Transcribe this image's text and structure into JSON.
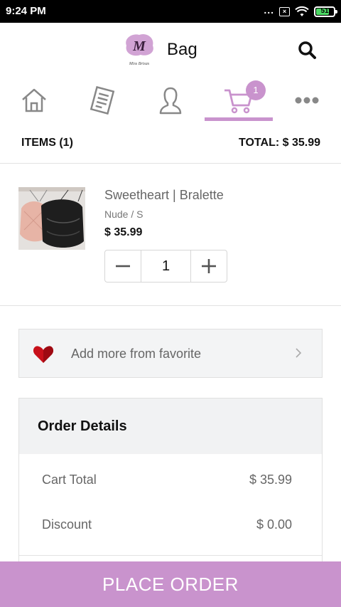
{
  "status_bar": {
    "time": "9:24 PM",
    "dots": "...",
    "battery": "51"
  },
  "header": {
    "title": "Bag",
    "logo_letter": "M",
    "logo_caption": "Miss Brisas"
  },
  "nav": {
    "items": [
      {
        "icon": "home-icon"
      },
      {
        "icon": "catalog-icon"
      },
      {
        "icon": "profile-icon"
      },
      {
        "icon": "cart-icon",
        "active": true,
        "badge": "1"
      },
      {
        "icon": "more-icon"
      }
    ],
    "accent": "#c993cd"
  },
  "summary": {
    "items_label": "ITEMS (1)",
    "total_label": "TOTAL: $ 35.99"
  },
  "product": {
    "name": "Sweetheart | Bralette",
    "variant": "Nude / S",
    "price": "$ 35.99",
    "quantity": "1"
  },
  "favorite": {
    "label": "Add more from favorite"
  },
  "order_details": {
    "title": "Order Details",
    "rows": [
      {
        "label": "Cart Total",
        "value": "$ 35.99"
      },
      {
        "label": "Discount",
        "value": "$ 0.00"
      }
    ]
  },
  "place_order": {
    "label": "PLACE ORDER"
  }
}
